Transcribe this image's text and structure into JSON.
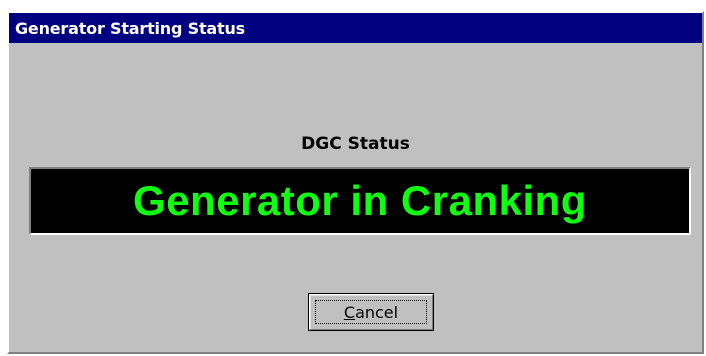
{
  "dialog": {
    "title": "Generator Starting Status",
    "status_label": "DGC Status",
    "status_value": "Generator in Cranking",
    "status_color": "#10ff10",
    "cancel_mnemonic": "C",
    "cancel_rest": "ancel"
  }
}
